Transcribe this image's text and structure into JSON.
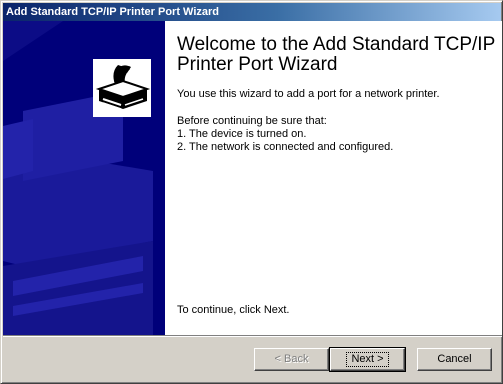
{
  "window": {
    "title": "Add Standard TCP/IP Printer Port Wizard"
  },
  "content": {
    "heading": "Welcome to the Add Standard TCP/IP Printer Port Wizard",
    "intro": "You use this wizard to add a port for a network printer.",
    "before_label": "Before continuing be sure that:",
    "checklist": [
      "1.  The device is turned on.",
      "2.  The network is connected and configured."
    ],
    "continue_hint": "To continue, click Next."
  },
  "buttons": {
    "back_label": "< Back",
    "next_label": "Next >",
    "cancel_label": "Cancel"
  },
  "colors": {
    "title_active": "#0a246a",
    "side_panel": "#00007a",
    "dialog_face": "#d4d0c8"
  },
  "icons": {
    "wizard": "printer-wizard-icon"
  }
}
